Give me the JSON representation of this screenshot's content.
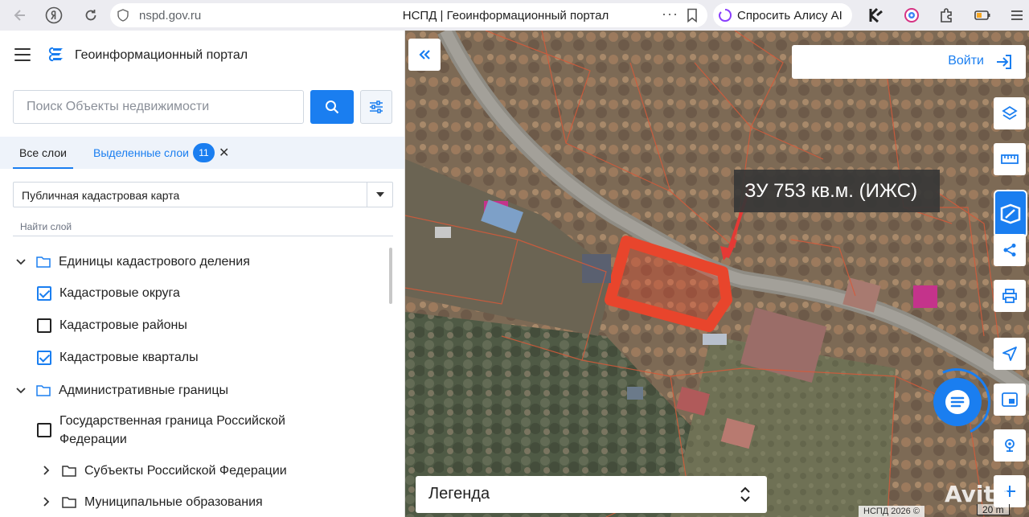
{
  "browser": {
    "url": "nspd.gov.ru",
    "page_title": "НСПД | Геоинформационный портал",
    "alice_label": "Спросить Алису AI",
    "more_dots": "···"
  },
  "panel": {
    "portal_title": "Геоинформационный портал",
    "search_placeholder": "Поиск Объекты недвижимости",
    "tab_all": "Все слои",
    "tab_selected": "Выделенные слои",
    "selected_count": "11",
    "basemap_select": "Публичная кадастровая карта",
    "find_layer": "Найти слой"
  },
  "tree": [
    {
      "label": "Единицы кадастрового деления",
      "kind": "folder",
      "expanded": true
    },
    {
      "label": "Кадастровые округа",
      "kind": "checkbox",
      "checked": true
    },
    {
      "label": "Кадастровые районы",
      "kind": "checkbox",
      "checked": false
    },
    {
      "label": "Кадастровые кварталы",
      "kind": "checkbox",
      "checked": true
    },
    {
      "label": "Административные границы",
      "kind": "folder",
      "expanded": true
    },
    {
      "label": "Государственная граница Российской Федерации",
      "kind": "checkbox",
      "checked": false
    },
    {
      "label": "Субъекты Российской Федерации",
      "kind": "folder",
      "expanded": false
    },
    {
      "label": "Муниципальные образования",
      "kind": "folder",
      "expanded": false
    }
  ],
  "map": {
    "login_label": "Войти",
    "annotation": "ЗУ 753 кв.м. (ИЖС)",
    "legend_label": "Легенда",
    "copyright": "НСПД 2026 ©",
    "scale": "20 m",
    "watermark": "Avito"
  },
  "colors": {
    "accent": "#1a7ef0",
    "parcel_highlight": "#e8452c",
    "annotation_arrow": "#e53935"
  },
  "icons": {
    "tools": [
      "layers-icon",
      "ruler-icon",
      "mark-icon",
      "share-icon",
      "print-icon",
      "navigate-icon",
      "minimap-icon",
      "location-icon",
      "zoom-in-icon"
    ]
  }
}
